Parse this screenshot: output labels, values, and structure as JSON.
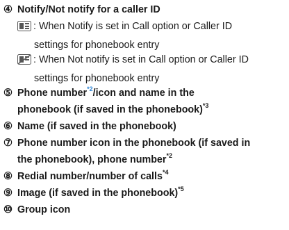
{
  "items": [
    {
      "marker": "④",
      "text": "Notify/Not notify for a caller ID"
    },
    {
      "marker": "⑤",
      "text_a": "Phone number",
      "sup_a": "*2",
      "text_b": "/icon and name in the",
      "line2": "phonebook (if saved in the phonebook)",
      "sup_b": "*3"
    },
    {
      "marker": "⑥",
      "text": "Name (if saved in the phonebook)"
    },
    {
      "marker": "⑦",
      "text": "Phone number icon in the phonebook (if saved in",
      "line2": "the phonebook), phone number",
      "sup": "*2"
    },
    {
      "marker": "⑧",
      "text": "Redial number/number of calls",
      "sup": "*4"
    },
    {
      "marker": "⑨",
      "text": "Image (if saved in the phonebook)",
      "sup": "*5"
    },
    {
      "marker": "⑩",
      "text": "Group icon"
    }
  ],
  "notify": {
    "line1": ": When Notify is set in Call option or Caller ID",
    "line2": "settings for phonebook entry",
    "icon": "notify-icon"
  },
  "not_notify": {
    "line1": ": When Not notify is set in Call option or Caller ID",
    "line2": "settings for phonebook entry",
    "icon": "not-notify-icon"
  },
  "colors": {
    "text": "#1a1a1a",
    "footnote_highlight": "#2f86d6"
  }
}
